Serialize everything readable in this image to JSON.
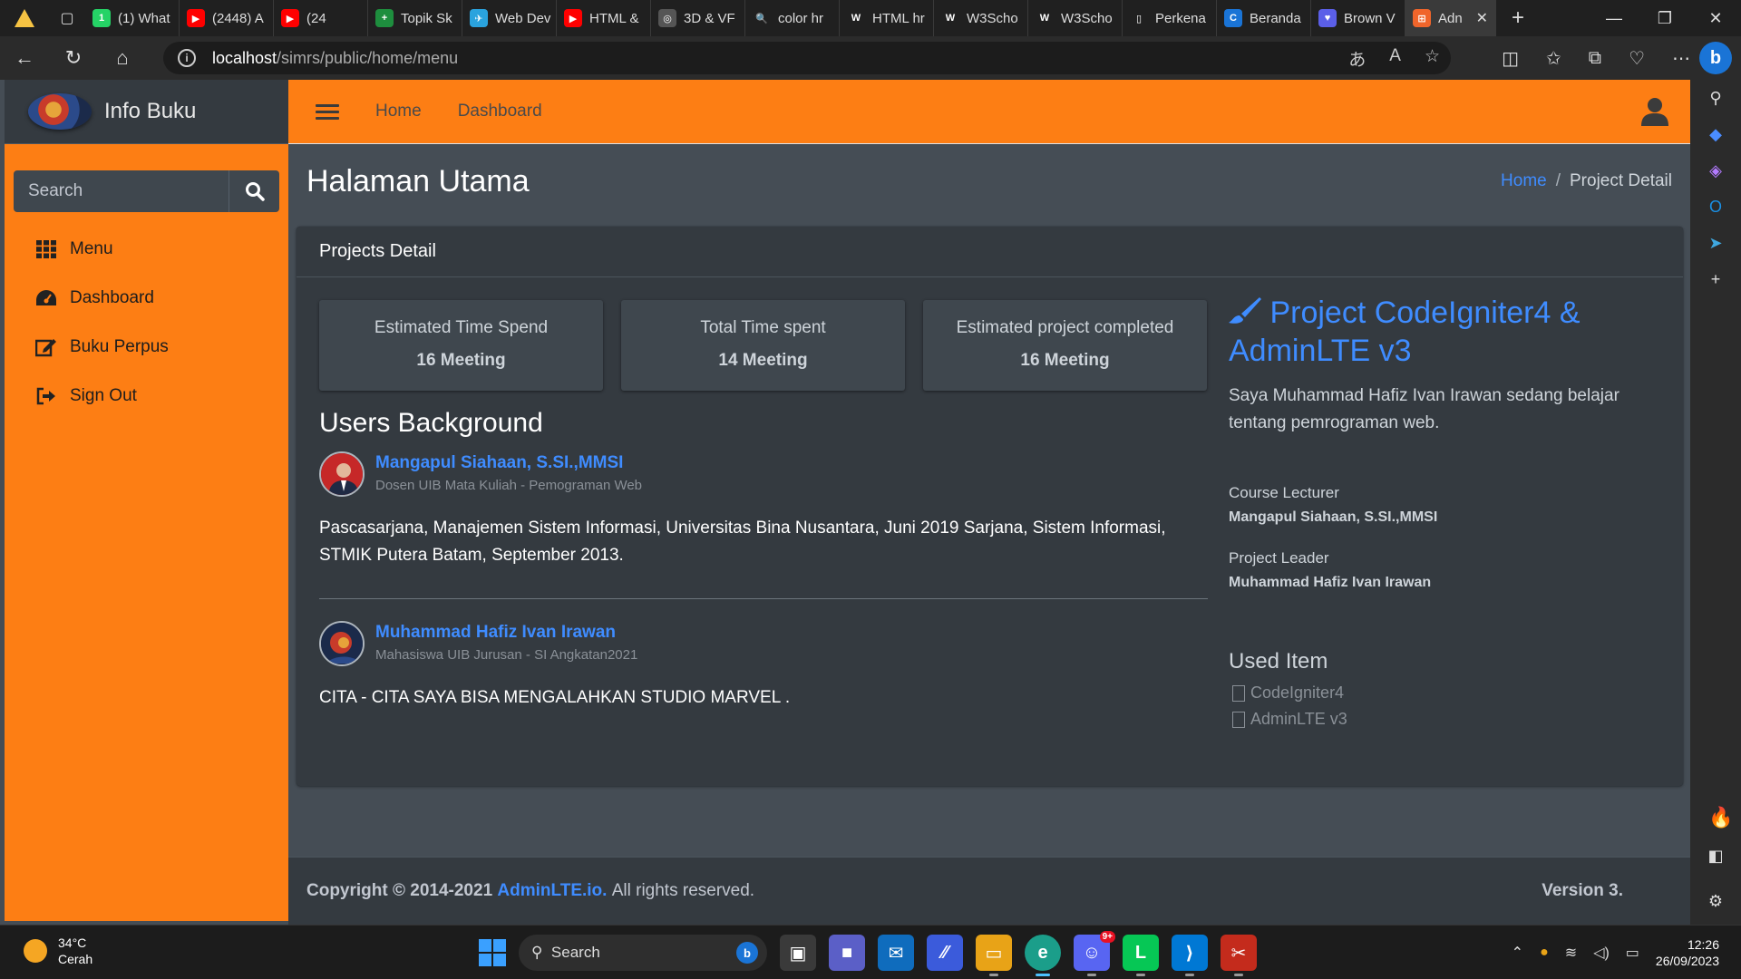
{
  "browser": {
    "tabs": [
      {
        "label": "(1) What",
        "color": "#25d366",
        "glyph": "1"
      },
      {
        "label": "(2448) A",
        "color": "#ff0000",
        "glyph": "▶"
      },
      {
        "label": "(24",
        "color": "#ff0000",
        "glyph": "▶"
      },
      {
        "label": "Topik Sk",
        "color": "#1e8e3e",
        "glyph": "+"
      },
      {
        "label": "Web Dev",
        "color": "#2aa3de",
        "glyph": "✈"
      },
      {
        "label": "HTML &",
        "color": "#ff0000",
        "glyph": "▶"
      },
      {
        "label": "3D & VF",
        "color": "#555555",
        "glyph": "◎"
      },
      {
        "label": "color hr",
        "color": "#202020",
        "glyph": "🔍"
      },
      {
        "label": "HTML hr",
        "color": "#202020",
        "glyph": "W"
      },
      {
        "label": "W3Scho",
        "color": "#202020",
        "glyph": "W"
      },
      {
        "label": "W3Scho",
        "color": "#202020",
        "glyph": "W"
      },
      {
        "label": "Perkena",
        "color": "#202020",
        "glyph": "▯"
      },
      {
        "label": "Beranda",
        "color": "#1a74d6",
        "glyph": "C"
      },
      {
        "label": "Brown V",
        "color": "#5b5fe8",
        "glyph": "♥"
      }
    ],
    "active_tab": {
      "label": "Adn",
      "color": "#f0652b",
      "glyph": "⊞"
    },
    "url_host": "localhost",
    "url_path": "/simrs/public/home/menu"
  },
  "sidebar": {
    "brand": "Info Buku",
    "search_placeholder": "Search",
    "items": [
      {
        "label": "Menu",
        "icon": "grid-icon"
      },
      {
        "label": "Dashboard",
        "icon": "tachometer-icon"
      },
      {
        "label": "Buku Perpus",
        "icon": "edit-icon"
      },
      {
        "label": "Sign Out",
        "icon": "sign-out-icon"
      }
    ]
  },
  "topnav": {
    "home": "Home",
    "dashboard": "Dashboard"
  },
  "content": {
    "title": "Halaman Utama",
    "breadcrumb": {
      "home": "Home",
      "sep": "/",
      "current": "Project Detail"
    }
  },
  "card": {
    "header": "Projects Detail",
    "infoboxes": [
      {
        "title": "Estimated Time Spend",
        "value": "16 Meeting"
      },
      {
        "title": "Total Time spent",
        "value": "14 Meeting"
      },
      {
        "title": "Estimated project completed",
        "value": "16 Meeting"
      }
    ],
    "users_title": "Users Background",
    "posts": [
      {
        "name": "Mangapul Siahaan, S.SI.,MMSI",
        "desc": "Dosen UIB Mata Kuliah - Pemograman Web",
        "body": "Pascasarjana, Manajemen Sistem Informasi, Universitas Bina Nusantara, Juni 2019 Sarjana, Sistem Informasi, STMIK Putera Batam, September 2013."
      },
      {
        "name": "Muhammad Hafiz Ivan Irawan",
        "desc": "Mahasiswa UIB Jurusan - SI Angkatan2021",
        "body": "CITA - CITA SAYA BISA MENGALAHKAN STUDIO MARVEL ."
      }
    ],
    "project": {
      "title": "Project CodeIgniter4 & AdminLTE v3",
      "desc": "Saya Muhammad Hafiz Ivan Irawan sedang belajar tentang pemrograman web.",
      "lecturer_label": "Course Lecturer",
      "lecturer": "Mangapul Siahaan, S.SI.,MMSI",
      "leader_label": "Project Leader",
      "leader": "Muhammad Hafiz Ivan Irawan",
      "used_title": "Used Item",
      "used_items": [
        "CodeIgniter4",
        "AdminLTE v3"
      ]
    }
  },
  "footer": {
    "copyright": "Copyright © 2014-2021",
    "link": "AdminLTE.io.",
    "rest": "All rights reserved.",
    "version": "Version 3."
  },
  "taskbar": {
    "temp": "34°C",
    "weather": "Cerah",
    "search": "Search",
    "time": "12:26",
    "date": "26/09/2023",
    "discord_badge": "9+"
  },
  "colors": {
    "sidebar": "#fd7e14",
    "link": "#3f8cff",
    "card": "#343a40",
    "content_bg": "#454d55"
  }
}
